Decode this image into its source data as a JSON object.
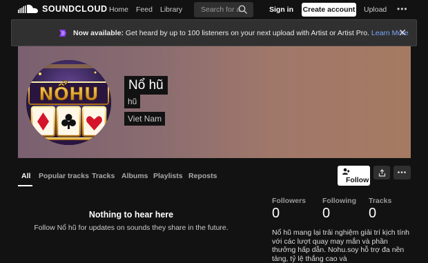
{
  "topbar": {
    "logo_text": "SOUNDCLOUD",
    "nav": [
      "Home",
      "Feed",
      "Library"
    ],
    "search_placeholder": "Search for a",
    "signin_label": "Sign in",
    "create_label": "Create account",
    "upload_label": "Upload",
    "more_label": "•••"
  },
  "banner": {
    "bold_text": "Now available:",
    "text": " Get heard by up to 100 listeners on your next upload with Artist or Artist Pro. ",
    "link_text": "Learn More",
    "close_label": "✕"
  },
  "profile": {
    "name": "Nổ hũ",
    "subname": "hũ",
    "location": "Viet Nam",
    "avatar_text": "NỔHU"
  },
  "tabs": [
    "All",
    "Popular tracks",
    "Tracks",
    "Albums",
    "Playlists",
    "Reposts"
  ],
  "actions": {
    "follow_label": "Follow",
    "more_label": "•••"
  },
  "empty": {
    "title": "Nothing to hear here",
    "subtitle": "Follow Nổ hũ for updates on sounds they share in the future."
  },
  "stats": [
    {
      "label": "Followers",
      "value": "0"
    },
    {
      "label": "Following",
      "value": "0"
    },
    {
      "label": "Tracks",
      "value": "0"
    }
  ],
  "bio": "Nổ hũ mang lại trải nghiệm giải trí kịch tính với các lượt quay may mắn và phần thưởng hấp dẫn. Nohu.soy hỗ trợ đa nền tảng, tỷ lệ thắng cao và",
  "colors": {
    "background": "#121212",
    "accent_link": "#7aa7ff",
    "banner_icon": "#8a3ffc"
  }
}
